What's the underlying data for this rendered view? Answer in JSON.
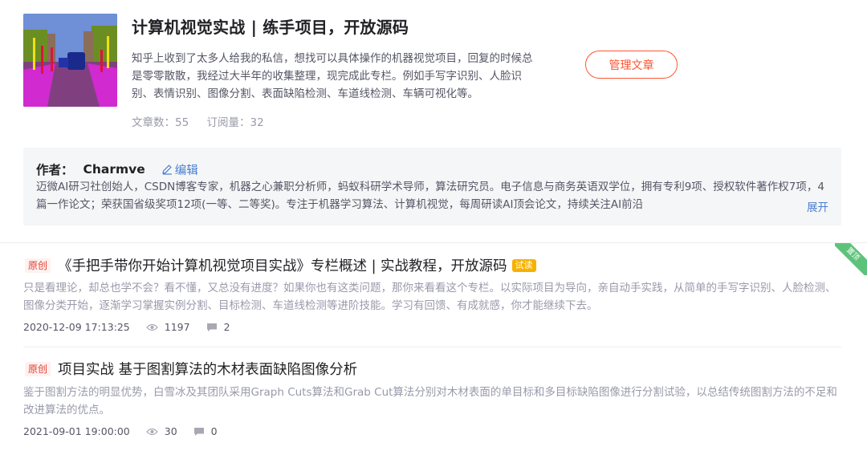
{
  "column": {
    "title": "计算机视觉实战 | 练手项目，开放源码",
    "description": "知乎上收到了太多人给我的私信，想找可以具体操作的机器视觉项目，回复的时候总是零零散散，我经过大半年的收集整理，现完成此专栏。例如手写字识别、人脸识别、表情识别、图像分割、表面缺陷检测、车道线检测、车辆可视化等。",
    "articles_count": "文章数：55",
    "subscribers_count": "订阅量：32",
    "manage_button": "管理文章"
  },
  "author": {
    "label": "作者：",
    "name": "Charmve",
    "edit_label": "编辑",
    "bio": "迈微AI研习社创始人，CSDN博客专家，机器之心兼职分析师，蚂蚁科研学术导师，算法研究员。电子信息与商务英语双学位，拥有专利9项、授权软件著作权7项，4篇一作论文；荣获国省级奖项12项(一等、二等奖)。专注于机器学习算法、计算机视觉，每周研读AI顶会论文，持续关注AI前沿",
    "expand_label": "展开"
  },
  "articles": [
    {
      "tag": "原创",
      "title": "《手把手带你开始计算机视觉项目实战》专栏概述 | 实战教程，开放源码",
      "trial_tag": "试读",
      "corner_badge": "置顶",
      "description": "只是看理论，却总也学不会？看不懂，又总没有进度？如果你也有这类问题，那你来看看这个专栏。以实际项目为导向，亲自动手实践，从简单的手写字识别、人脸检测、图像分类开始，逐渐学习掌握实例分割、目标检测、车道线检测等进阶技能。学习有回馈、有成就感，你才能继续下去。",
      "date": "2020-12-09 17:13:25",
      "views": "1197",
      "comments": "2"
    },
    {
      "tag": "原创",
      "title": "项目实战 基于图割算法的木材表面缺陷图像分析",
      "description": "鉴于图割方法的明显优势，白雪冰及其团队采用Graph Cuts算法和Grab Cut算法分别对木材表面的单目标和多目标缺陷图像进行分割试验，以总结传统图割方法的不足和改进算法的优点。",
      "date": "2021-09-01 19:00:00",
      "views": "30",
      "comments": "0"
    }
  ],
  "colors": {
    "accent": "#fc5531",
    "link": "#4a7fd0",
    "tag_red": "#e33e33",
    "trial": "#f7b100",
    "badge_green": "#5ec37a"
  }
}
